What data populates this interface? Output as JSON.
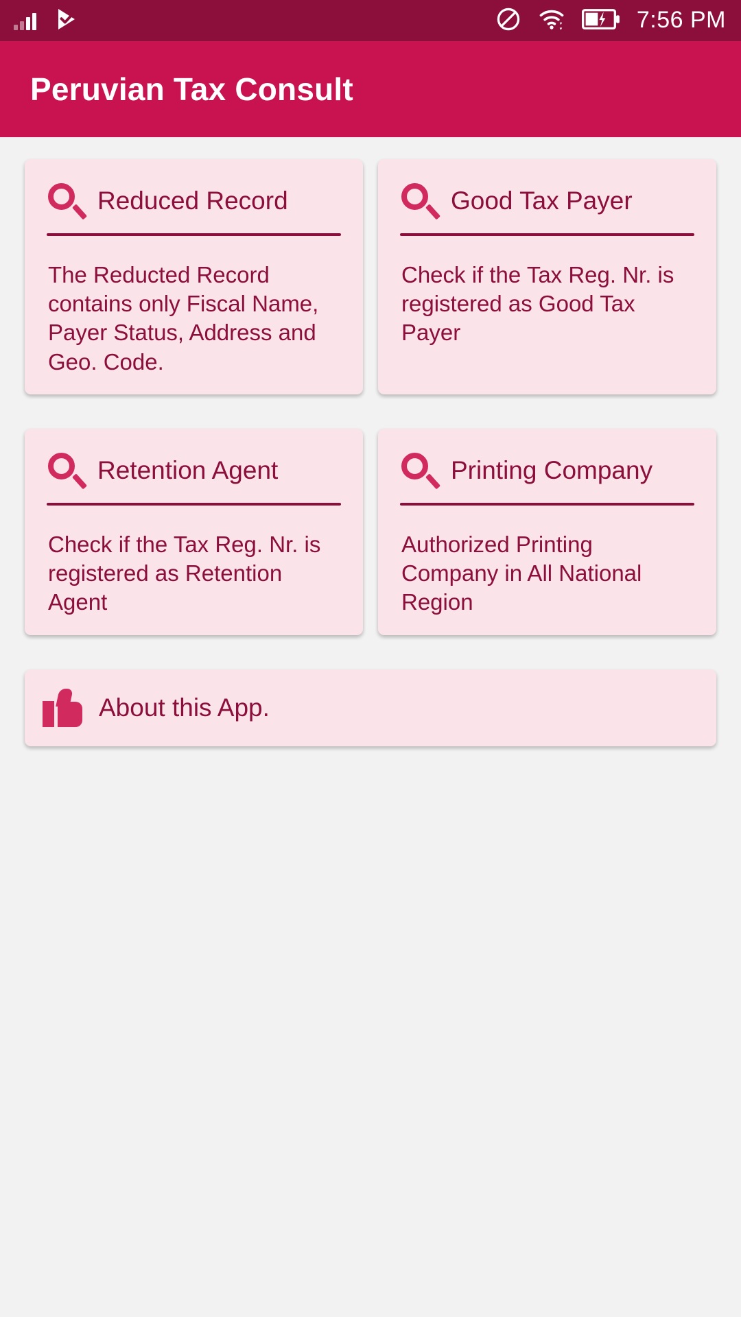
{
  "status_bar": {
    "time": "7:56 PM",
    "icons": [
      "signal-bars-icon",
      "app-notification-icon",
      "do-not-disturb-icon",
      "wifi-icon",
      "battery-charging-icon"
    ],
    "background_color": "#8c0f3b"
  },
  "app_bar": {
    "title": "Peruvian Tax Consult",
    "background_color": "#c91350",
    "text_color": "#ffffff"
  },
  "theme": {
    "page_background": "#f2f2f2",
    "card_background": "#fbe3ea",
    "accent": "#d02a5e",
    "text_primary": "#8c0f3b"
  },
  "main": {
    "rows": [
      [
        {
          "icon": "search-icon",
          "title": "Reduced Record",
          "body": "The Reducted Record contains only Fiscal Name, Payer Status, Address and Geo. Code."
        },
        {
          "icon": "search-icon",
          "title": "Good Tax Payer",
          "body": "Check if the Tax Reg. Nr. is registered as Good Tax Payer"
        }
      ],
      [
        {
          "icon": "search-icon",
          "title": "Retention Agent",
          "body": "Check if the Tax Reg. Nr. is registered as Retention Agent"
        },
        {
          "icon": "search-icon",
          "title": "Printing Company",
          "body": "Authorized Printing Company in All National Region"
        }
      ]
    ],
    "about": {
      "icon": "thumbs-up-icon",
      "title": "About this App."
    }
  }
}
